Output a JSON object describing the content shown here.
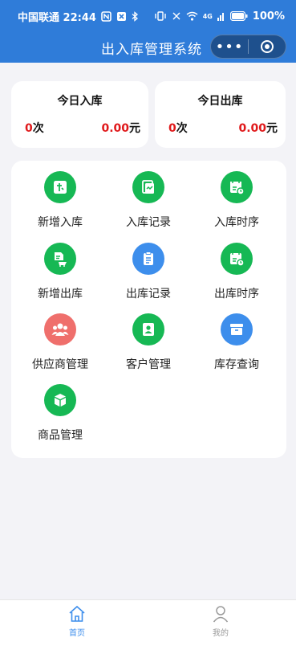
{
  "status_bar": {
    "carrier_time": "中国联通 22:44",
    "battery": "100%",
    "network": "4G"
  },
  "nav": {
    "title": "出入库管理系统",
    "more_label": "•••"
  },
  "stats": {
    "in": {
      "title": "今日入库",
      "count": "0",
      "count_unit": "次",
      "amount": "0.00",
      "amount_unit": "元"
    },
    "out": {
      "title": "今日出库",
      "count": "0",
      "count_unit": "次",
      "amount": "0.00",
      "amount_unit": "元"
    }
  },
  "menu": {
    "items": [
      {
        "label": "新增入库",
        "icon": "inbound-add-icon",
        "color": "#16b854"
      },
      {
        "label": "入库记录",
        "icon": "inbound-record-icon",
        "color": "#16b854"
      },
      {
        "label": "入库时序",
        "icon": "inbound-timeline-icon",
        "color": "#16b854"
      },
      {
        "label": "新增出库",
        "icon": "outbound-add-icon",
        "color": "#16b854"
      },
      {
        "label": "出库记录",
        "icon": "clipboard-icon",
        "color": "#3d8eec"
      },
      {
        "label": "出库时序",
        "icon": "outbound-timeline-icon",
        "color": "#16b854"
      },
      {
        "label": "供应商管理",
        "icon": "supplier-group-icon",
        "color": "#ef6f6c"
      },
      {
        "label": "客户管理",
        "icon": "customer-card-icon",
        "color": "#16b854"
      },
      {
        "label": "库存查询",
        "icon": "inventory-box-icon",
        "color": "#3d8eec"
      },
      {
        "label": "商品管理",
        "icon": "product-cube-icon",
        "color": "#16b854"
      }
    ]
  },
  "tabbar": {
    "home_label": "首页",
    "mine_label": "我的",
    "active_color": "#3d8eec",
    "inactive_color": "#9a9a9a"
  }
}
